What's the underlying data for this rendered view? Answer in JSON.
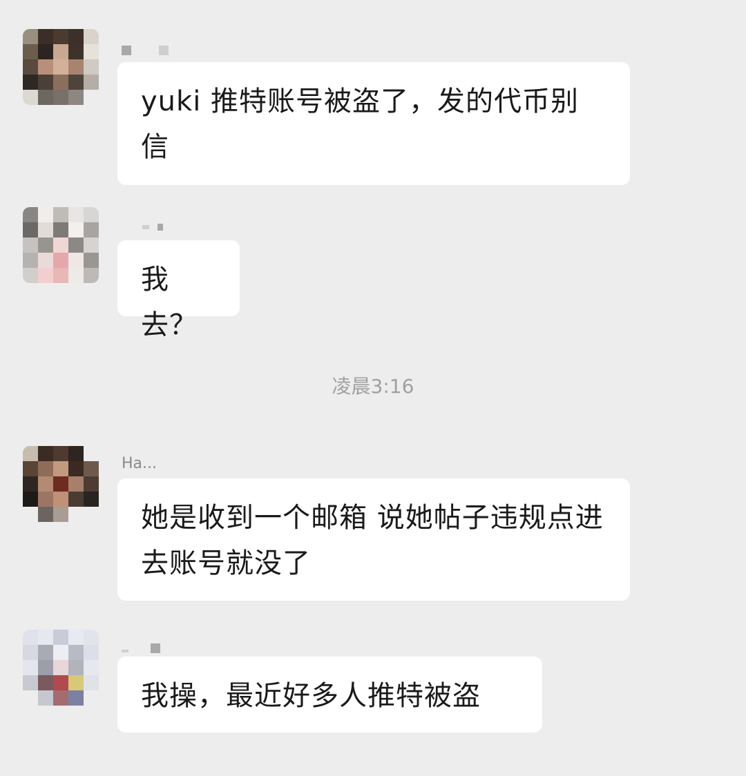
{
  "messages": [
    {
      "sender": "",
      "text": "yuki 推特账号被盗了，发的代币别信"
    },
    {
      "sender": "",
      "text": "我去？"
    },
    {
      "sender": "Ha...",
      "text": "她是收到一个邮箱 说她帖子违规点进去账号就没了"
    },
    {
      "sender": "",
      "text": "我操，最近好多人推特被盗"
    }
  ],
  "timestamp": "凌晨3:16"
}
